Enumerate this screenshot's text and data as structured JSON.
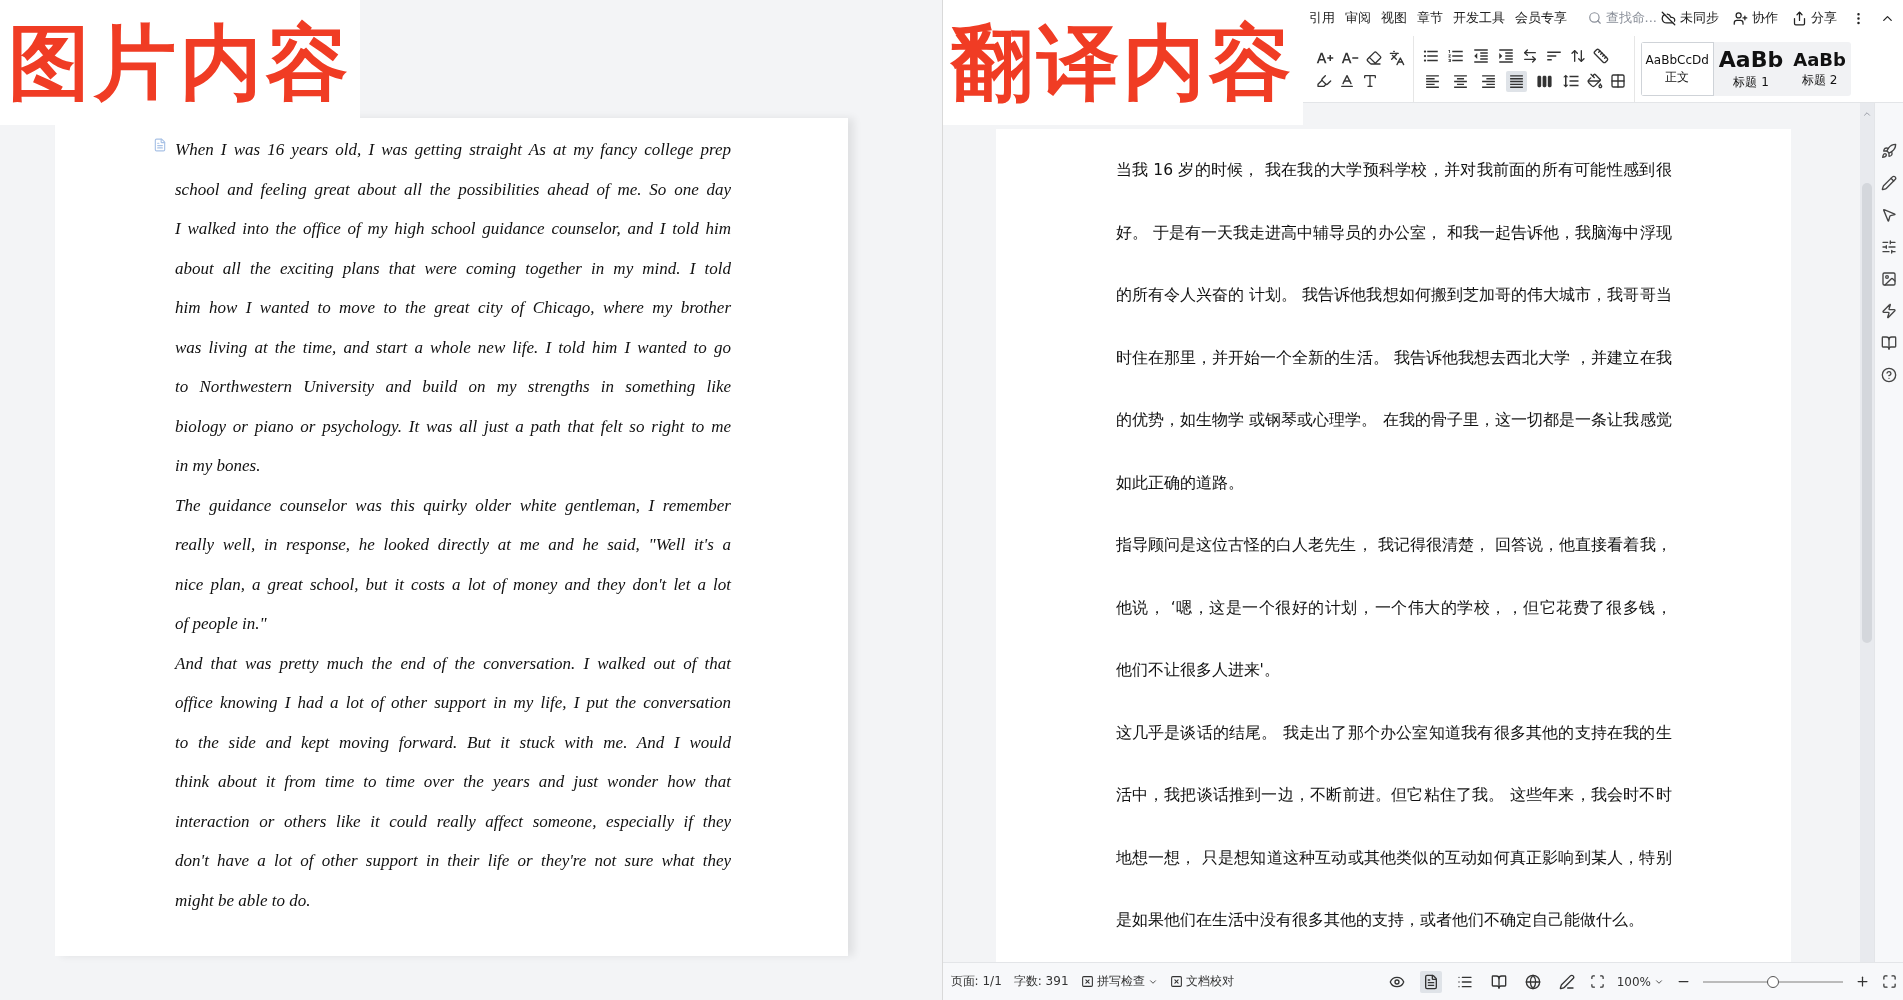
{
  "left_panel": {
    "label": "图片内容",
    "paragraphs": [
      {
        "lines": [
          "When I was 16 years old, I was getting straight As at my fancy college prep",
          "school and feeling great about all the possibilities ahead of me. So one day",
          "I walked into the office of my high school guidance counselor, and I told him",
          "about all the exciting plans that were coming together in my mind. I told",
          "him how I wanted to move to the great city of Chicago, where my brother",
          "was living at the time, and start a whole new life. I told him I wanted to go",
          "to Northwestern University and build on my strengths in something like",
          "biology or piano or psychology. It was all just a path that felt so right to me",
          "in my bones."
        ]
      },
      {
        "lines": [
          "The guidance counselor was this quirky older white gentleman, I remember",
          "really well, in response, he looked directly at me and he said, \"Well it's a",
          "nice plan, a great school, but it costs a lot of money and they don't let a lot",
          "of people in.\""
        ]
      },
      {
        "lines": [
          "And that was pretty much the end of the conversation. I walked out of that",
          "office knowing I had a lot of other support in my life, I put the conversation",
          "to the side and kept moving forward. But it stuck with me. And I would",
          "think about it from time to time over the years and just wonder how that",
          "interaction or others like it could really affect someone, especially if they",
          "don't have a lot of other support in their life or they're not sure what they",
          "might be able to do."
        ]
      }
    ]
  },
  "right_panel": {
    "label": "翻译内容",
    "menu_tabs": [
      {
        "label": "引用"
      },
      {
        "label": "审阅"
      },
      {
        "label": "视图"
      },
      {
        "label": "章节"
      },
      {
        "label": "开发工具"
      },
      {
        "label": "会员专享"
      }
    ],
    "search": {
      "placeholder": "查找命..."
    },
    "header_actions": [
      {
        "kind": "sync",
        "label": "未同步"
      },
      {
        "kind": "collab",
        "label": "协作"
      },
      {
        "kind": "share",
        "label": "分享"
      }
    ],
    "alignment": [
      {
        "kind": "left",
        "selected": false
      },
      {
        "kind": "center",
        "selected": false
      },
      {
        "kind": "right",
        "selected": false
      },
      {
        "kind": "justify",
        "selected": true
      },
      {
        "kind": "distribute",
        "selected": false
      }
    ],
    "styles": [
      {
        "preview": "AaBbCcDd",
        "name": "正文",
        "kind": "body",
        "selected": true
      },
      {
        "preview": "AaBb",
        "name": "标题 1",
        "kind": "h1",
        "selected": false
      },
      {
        "preview": "AaBb",
        "name": "标题 2",
        "kind": "h2",
        "selected": false
      }
    ],
    "paragraphs": [
      {
        "lines": [
          "当我 16 岁的时候， 我在我的大学预科学校，并对我前面的所有可能性感到很",
          "好。 于是有一天我走进高中辅导员的办公室， 和我一起告诉他，我脑海中浮现",
          "的所有令人兴奋的 计划。 我告诉他我想如何搬到芝加哥的伟大城市，我哥哥当",
          "时住在那里，并开始一个全新的生活。 我告诉他我想去西北大学 ，并建立在我",
          "的优势，如生物学 或钢琴或心理学。 在我的骨子里，这一切都是一条让我感觉",
          "如此正确的道路。"
        ]
      },
      {
        "lines": [
          "指导顾问是这位古怪的白人老先生， 我记得很清楚， 回答说，他直接看着我，",
          "他说， ‘嗯，这是一个很好的计划，一个伟大的学校，，但它花费了很多钱，",
          "他们不让很多人进来'。"
        ]
      },
      {
        "lines": [
          "这几乎是谈话的结尾。 我走出了那个办公室知道我有很多其他的支持在我的生",
          "活中，我把谈话推到一边，不断前进。但它粘住了我。 这些年来，我会时不时",
          "地想一想， 只是想知道这种互动或其他类似的互动如何真正影响到某人，特别",
          "是如果他们在生活中没有很多其他的支持，或者他们不确定自己能做什么。"
        ]
      }
    ],
    "status_bar": {
      "page": "页面: 1/1",
      "words": "字数: 391",
      "spell_check": "拼写检查",
      "proofread": "文档校对",
      "views": [
        {
          "kind": "read",
          "selected": false
        },
        {
          "kind": "page",
          "selected": true
        },
        {
          "kind": "outline",
          "selected": false
        },
        {
          "kind": "book",
          "selected": false
        },
        {
          "kind": "web",
          "selected": false
        },
        {
          "kind": "write",
          "selected": false
        }
      ],
      "zoom": "100%",
      "zoom_slider": {
        "level": 0.5
      }
    }
  }
}
